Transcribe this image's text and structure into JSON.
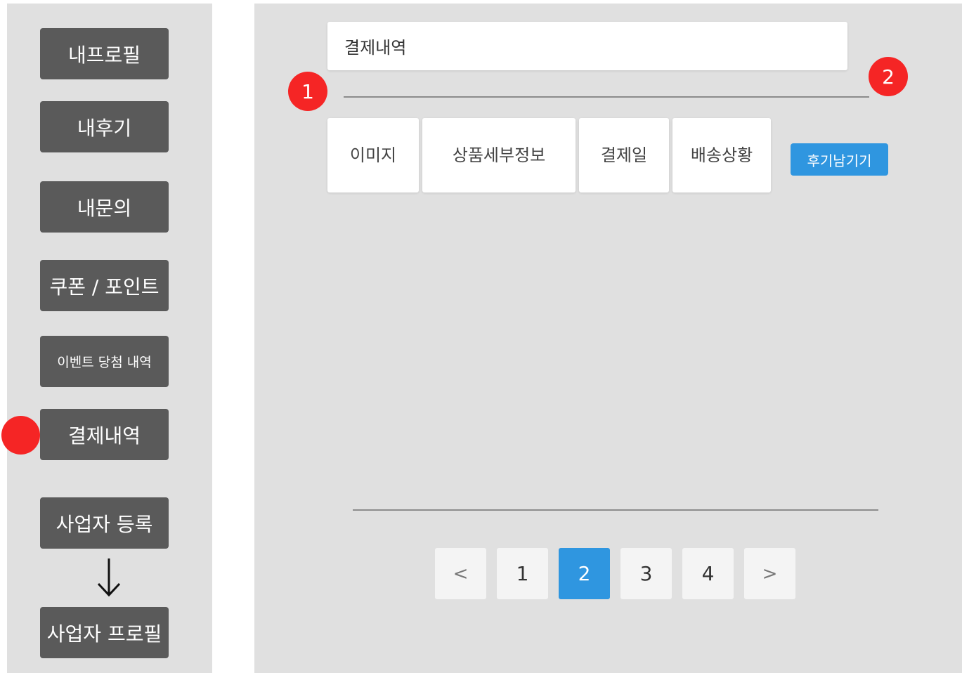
{
  "sidebar": {
    "items": [
      {
        "label": "내프로필"
      },
      {
        "label": "내후기"
      },
      {
        "label": "내문의"
      },
      {
        "label": "쿠폰 / 포인트"
      },
      {
        "label": "이벤트 당첨 내역"
      },
      {
        "label": "결제내역"
      },
      {
        "label": "사업자 등록"
      },
      {
        "label": "사업자 프로필"
      }
    ],
    "active_item": "결제내역",
    "marker_color": "#f52525"
  },
  "main": {
    "title": "결제내역",
    "badges": [
      "1",
      "2"
    ],
    "columns": [
      "이미지",
      "상품세부정보",
      "결제일",
      "배송상황"
    ],
    "review_button": "후기남기기"
  },
  "pagination": {
    "prev": "<",
    "next": ">",
    "pages": [
      "1",
      "2",
      "3",
      "4"
    ],
    "current": "2"
  },
  "colors": {
    "accent": "#2f96e0",
    "badge": "#f52525",
    "sidebar_button": "#5a5a5a",
    "panel_background": "#e0e0e0"
  },
  "icons": {
    "flow_arrow": "arrow-down-icon"
  }
}
